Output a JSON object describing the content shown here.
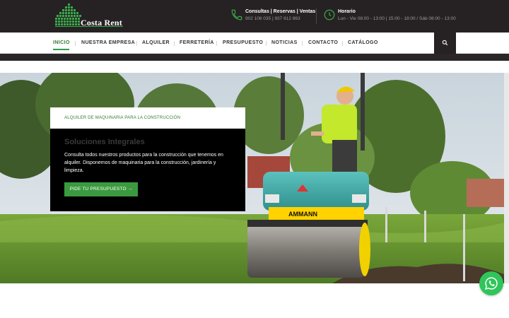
{
  "header": {
    "logo_text": "Costa Rent",
    "contact": {
      "title": "Consultas | Reservas | Ventas",
      "phones": "902 106 035 | 937 612 863"
    },
    "hours": {
      "title": "Horario",
      "text": "Lun - Vie 08:00 - 13:00 | 15:00 - 18:00 / Sáb 08:00 - 13:00"
    }
  },
  "nav": {
    "items": [
      {
        "label": "INICIO",
        "active": true
      },
      {
        "label": "NUESTRA EMPRESA"
      },
      {
        "label": "ALQUILER"
      },
      {
        "label": "FERRETERÍA"
      },
      {
        "label": "PRESUPUESTO"
      },
      {
        "label": "NOTICIAS"
      },
      {
        "label": "CONTACTO"
      },
      {
        "label": "CATÁLOGO"
      }
    ]
  },
  "hero": {
    "subtitle": "ALQUILER DE MAQUINARIA PARA LA CONSTRUCCIÓN",
    "title": "Soluciones Integrales",
    "body": "Consulta todos nuestros productos para la construcción que tenemos en alquiler. Disponemos de maquinaria para la construcción, jardinería y limpieza.",
    "cta_label": "PIDE TU PRESUPUESTO →",
    "machine_brand": "AMMANN"
  },
  "colors": {
    "accent": "#2e9e47",
    "topbar": "#262223",
    "cta": "#3b9a3f",
    "whatsapp": "#2fc55a"
  }
}
